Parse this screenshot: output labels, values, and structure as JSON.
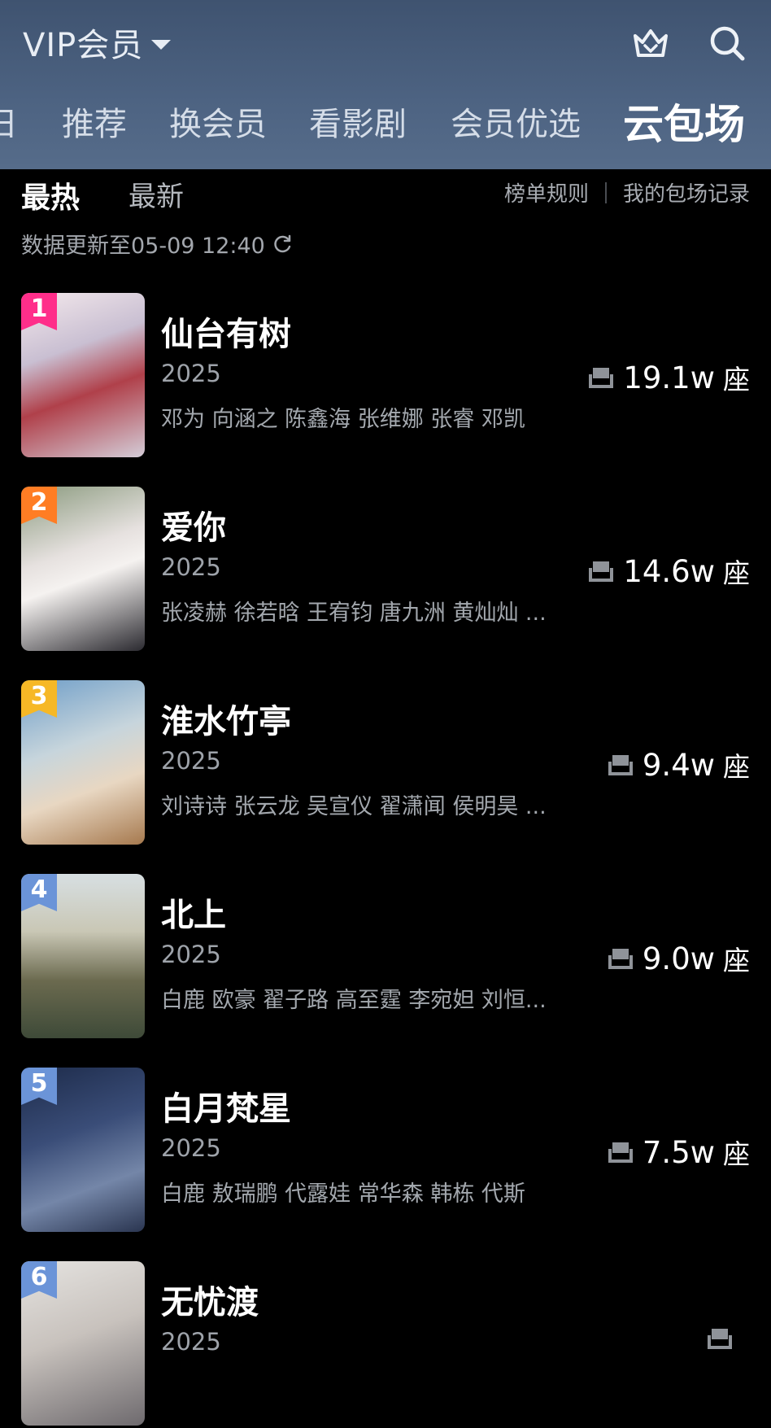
{
  "header": {
    "menu_label": "VIP会员",
    "tabs": [
      "日",
      "推荐",
      "换会员",
      "看影剧",
      "会员优选",
      "云包场"
    ],
    "active_tab": "云包场"
  },
  "subbar": {
    "hot": "最热",
    "new": "最新",
    "rules": "榜单规则",
    "records": "我的包场记录"
  },
  "update_text": "数据更新至05-09 12:40",
  "items": [
    {
      "rank": "1",
      "title": "仙台有树",
      "year": "2025",
      "cast": "邓为 向涵之 陈鑫海 张维娜 张睿 邓凯",
      "seats": "19.1w",
      "unit": "座",
      "rank_color": "#ff2e8a"
    },
    {
      "rank": "2",
      "title": "爱你",
      "year": "2025",
      "cast": "张凌赫 徐若晗 王宥钧 唐九洲 黄灿灿 ...",
      "seats": "14.6w",
      "unit": "座",
      "rank_color": "#ff7d24"
    },
    {
      "rank": "3",
      "title": "淮水竹亭",
      "year": "2025",
      "cast": "刘诗诗 张云龙 吴宣仪 翟潇闻 侯明昊 ...",
      "seats": "9.4w",
      "unit": "座",
      "rank_color": "#f6b826"
    },
    {
      "rank": "4",
      "title": "北上",
      "year": "2025",
      "cast": "白鹿 欧豪 翟子路 高至霆 李宛妲 刘恒...",
      "seats": "9.0w",
      "unit": "座",
      "rank_color": "#6b94d8"
    },
    {
      "rank": "5",
      "title": "白月梵星",
      "year": "2025",
      "cast": "白鹿 敖瑞鹏 代露娃 常华森 韩栋 代斯",
      "seats": "7.5w",
      "unit": "座",
      "rank_color": "#6b94d8"
    },
    {
      "rank": "6",
      "title": "无忧渡",
      "year": "2025",
      "cast": "",
      "seats": "",
      "unit": "",
      "rank_color": "#6b94d8"
    }
  ]
}
